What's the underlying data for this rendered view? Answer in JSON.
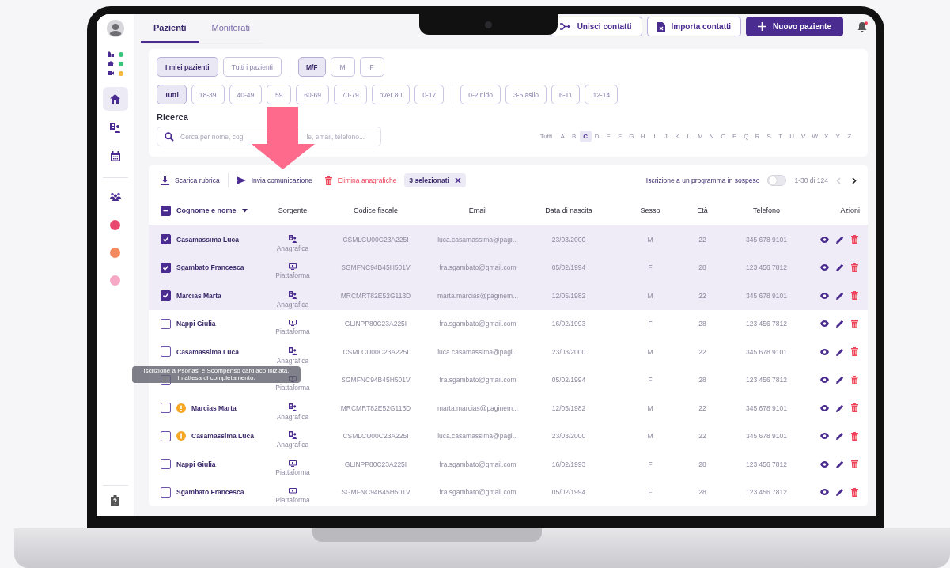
{
  "tabs": [
    {
      "label": "Pazienti",
      "selected": true
    },
    {
      "label": "Monitorati",
      "selected": false
    }
  ],
  "header_buttons": [
    {
      "label": "Unisci contatti",
      "kind": "merge"
    },
    {
      "label": "Importa contatti",
      "kind": "import"
    },
    {
      "label": "Nuovo paziente",
      "kind": "new"
    }
  ],
  "notifications": {
    "unread": true
  },
  "sidebar": {
    "status": [
      {
        "kind": "building",
        "color": "#3cc47c"
      },
      {
        "kind": "home",
        "color": "#3cc47c"
      },
      {
        "kind": "video",
        "color": "#f2b53d"
      }
    ],
    "nav": [
      {
        "kind": "home",
        "selected": true
      },
      {
        "kind": "records",
        "selected": false
      },
      {
        "kind": "calendar",
        "selected": false
      },
      {
        "kind": "group",
        "selected": false
      }
    ],
    "dots": [
      {
        "color": "#e84a6f"
      },
      {
        "color": "#f4895f"
      },
      {
        "color": "#f7a8c4"
      }
    ]
  },
  "filters": {
    "scope": [
      {
        "label": "I miei pazienti",
        "selected": true
      },
      {
        "label": "Tutti i pazienti",
        "selected": false
      }
    ],
    "sex": [
      {
        "label": "M/F",
        "selected": true
      },
      {
        "label": "M",
        "selected": false
      },
      {
        "label": "F",
        "selected": false
      }
    ],
    "ages": [
      {
        "label": "Tutti",
        "selected": true
      },
      {
        "label": "18-39",
        "selected": false
      },
      {
        "label": "40-49",
        "selected": false
      },
      {
        "label": "59",
        "selected": false
      },
      {
        "label": "60-69",
        "selected": false
      },
      {
        "label": "70-79",
        "selected": false
      },
      {
        "label": "over 80",
        "selected": false
      },
      {
        "label": "0-17",
        "selected": false
      }
    ],
    "child_ages": [
      {
        "label": "0-2 nido",
        "selected": false
      },
      {
        "label": "3-5 asilo",
        "selected": false
      },
      {
        "label": "6-11",
        "selected": false
      },
      {
        "label": "12-14",
        "selected": false
      }
    ]
  },
  "search": {
    "label": "Ricerca",
    "placeholder_parts": [
      "Cerca per nome, cog",
      "le, email, telefono..."
    ]
  },
  "alphabet": [
    {
      "label": "Tutti",
      "selected": false
    },
    {
      "label": "A",
      "selected": false
    },
    {
      "label": "B",
      "selected": false
    },
    {
      "label": "C",
      "selected": true
    },
    {
      "label": "D",
      "selected": false
    },
    {
      "label": "E",
      "selected": false
    },
    {
      "label": "F",
      "selected": false
    },
    {
      "label": "G",
      "selected": false
    },
    {
      "label": "H",
      "selected": false
    },
    {
      "label": "I",
      "selected": false
    },
    {
      "label": "J",
      "selected": false
    },
    {
      "label": "K",
      "selected": false
    },
    {
      "label": "L",
      "selected": false
    },
    {
      "label": "M",
      "selected": false
    },
    {
      "label": "N",
      "selected": false
    },
    {
      "label": "O",
      "selected": false
    },
    {
      "label": "P",
      "selected": false
    },
    {
      "label": "Q",
      "selected": false
    },
    {
      "label": "R",
      "selected": false
    },
    {
      "label": "S",
      "selected": false
    },
    {
      "label": "T",
      "selected": false
    },
    {
      "label": "U",
      "selected": false
    },
    {
      "label": "V",
      "selected": false
    },
    {
      "label": "W",
      "selected": false
    },
    {
      "label": "X",
      "selected": false
    },
    {
      "label": "Y",
      "selected": false
    },
    {
      "label": "Z",
      "selected": false
    }
  ],
  "toolbar": {
    "actions": [
      {
        "label": "Scarica rubrica",
        "kind": "download"
      },
      {
        "label": "Invia comunicazione",
        "kind": "send"
      },
      {
        "label": "Elimina anagrafiche",
        "kind": "delete"
      }
    ],
    "selection": "3 selezionati",
    "pending": {
      "label": "Iscrizione a un programma in sospeso",
      "on": false
    },
    "range": "1-30 di 124"
  },
  "table": {
    "header_checkbox": {
      "indeterminate": true
    },
    "columns": [
      {
        "label": "Cognome e nome",
        "sorted": true
      },
      {
        "label": "Sorgente",
        "sorted": false
      },
      {
        "label": "Codice fiscale",
        "sorted": false
      },
      {
        "label": "Email",
        "sorted": false
      },
      {
        "label": "Data di nascita",
        "sorted": false
      },
      {
        "label": "Sesso",
        "sorted": false
      },
      {
        "label": "Età",
        "sorted": false
      },
      {
        "label": "Telefono",
        "sorted": false
      },
      {
        "label": "Azioni",
        "sorted": false
      }
    ],
    "rows": [
      {
        "selected": true,
        "warning": false,
        "name": "Casamassima Luca",
        "source": {
          "kind": "anagrafica",
          "label": "Anagrafica"
        },
        "code": "CSMLCU00C23A225I",
        "email": "luca.casamassima@pagi...",
        "birth": "23/03/2000",
        "sex": "M",
        "age": "22",
        "phone": "345 678 9101"
      },
      {
        "selected": true,
        "warning": false,
        "name": "Sgambato Francesca",
        "source": {
          "kind": "piattaforma",
          "label": "Piattaforma"
        },
        "code": "SGMFNC94B45H501V",
        "email": "fra.sgambato@gmail.com",
        "birth": "05/02/1994",
        "sex": "F",
        "age": "28",
        "phone": "123 456 7812"
      },
      {
        "selected": true,
        "warning": false,
        "name": "Marcias Marta",
        "source": {
          "kind": "anagrafica",
          "label": "Anagrafica"
        },
        "code": "MRCMRT82E52G113D",
        "email": "marta.marcias@paginem...",
        "birth": "12/05/1982",
        "sex": "M",
        "age": "22",
        "phone": "345 678 9101"
      },
      {
        "selected": false,
        "warning": false,
        "name": "Nappi Giulia",
        "source": {
          "kind": "piattaforma",
          "label": "Piattaforma"
        },
        "code": "GLINPP80C23A225I",
        "email": "fra.sgambato@gmail.com",
        "birth": "16/02/1993",
        "sex": "F",
        "age": "28",
        "phone": "123 456 7812"
      },
      {
        "selected": false,
        "warning": false,
        "name": "Casamassima Luca",
        "source": {
          "kind": "anagrafica",
          "label": "Anagrafica"
        },
        "code": "CSMLCU00C23A225I",
        "email": "luca.casamassima@pagi...",
        "birth": "23/03/2000",
        "sex": "M",
        "age": "22",
        "phone": "345 678 9101"
      },
      {
        "selected": false,
        "warning": false,
        "source": {
          "kind": "piattaforma",
          "label": "Piattaforma"
        },
        "code": "SGMFNC94B45H501V",
        "email": "fra.sgambato@gmail.com",
        "birth": "05/02/1994",
        "sex": "F",
        "age": "28",
        "phone": "123 456 7812",
        "tooltip": [
          "Iscrizione a Psoriasi e Scompenso cardiaco iniziata.",
          "In attesa di completamento."
        ]
      },
      {
        "selected": false,
        "warning": true,
        "name": "Marcias Marta",
        "source": {
          "kind": "anagrafica",
          "label": "Anagrafica"
        },
        "code": "MRCMRT82E52G113D",
        "email": "marta.marcias@paginem...",
        "birth": "12/05/1982",
        "sex": "M",
        "age": "22",
        "phone": "345 678 9101"
      },
      {
        "selected": false,
        "warning": true,
        "name": "Casamassima Luca",
        "source": {
          "kind": "anagrafica",
          "label": "Anagrafica"
        },
        "code": "CSMLCU00C23A225I",
        "email": "luca.casamassima@pagi...",
        "birth": "23/03/2000",
        "sex": "M",
        "age": "22",
        "phone": "345 678 9101"
      },
      {
        "selected": false,
        "warning": false,
        "name": "Nappi Giulia",
        "source": {
          "kind": "piattaforma",
          "label": "Piattaforma"
        },
        "code": "GLINPP80C23A225I",
        "email": "fra.sgambato@gmail.com",
        "birth": "16/02/1993",
        "sex": "F",
        "age": "28",
        "phone": "123 456 7812"
      },
      {
        "selected": false,
        "warning": false,
        "name": "Sgambato Francesca",
        "source": {
          "kind": "piattaforma",
          "label": "Piattaforma"
        },
        "code": "SGMFNC94B45H501V",
        "email": "fra.sgambato@gmail.com",
        "birth": "05/02/1994",
        "sex": "F",
        "age": "28",
        "phone": "123 456 7812"
      }
    ]
  }
}
